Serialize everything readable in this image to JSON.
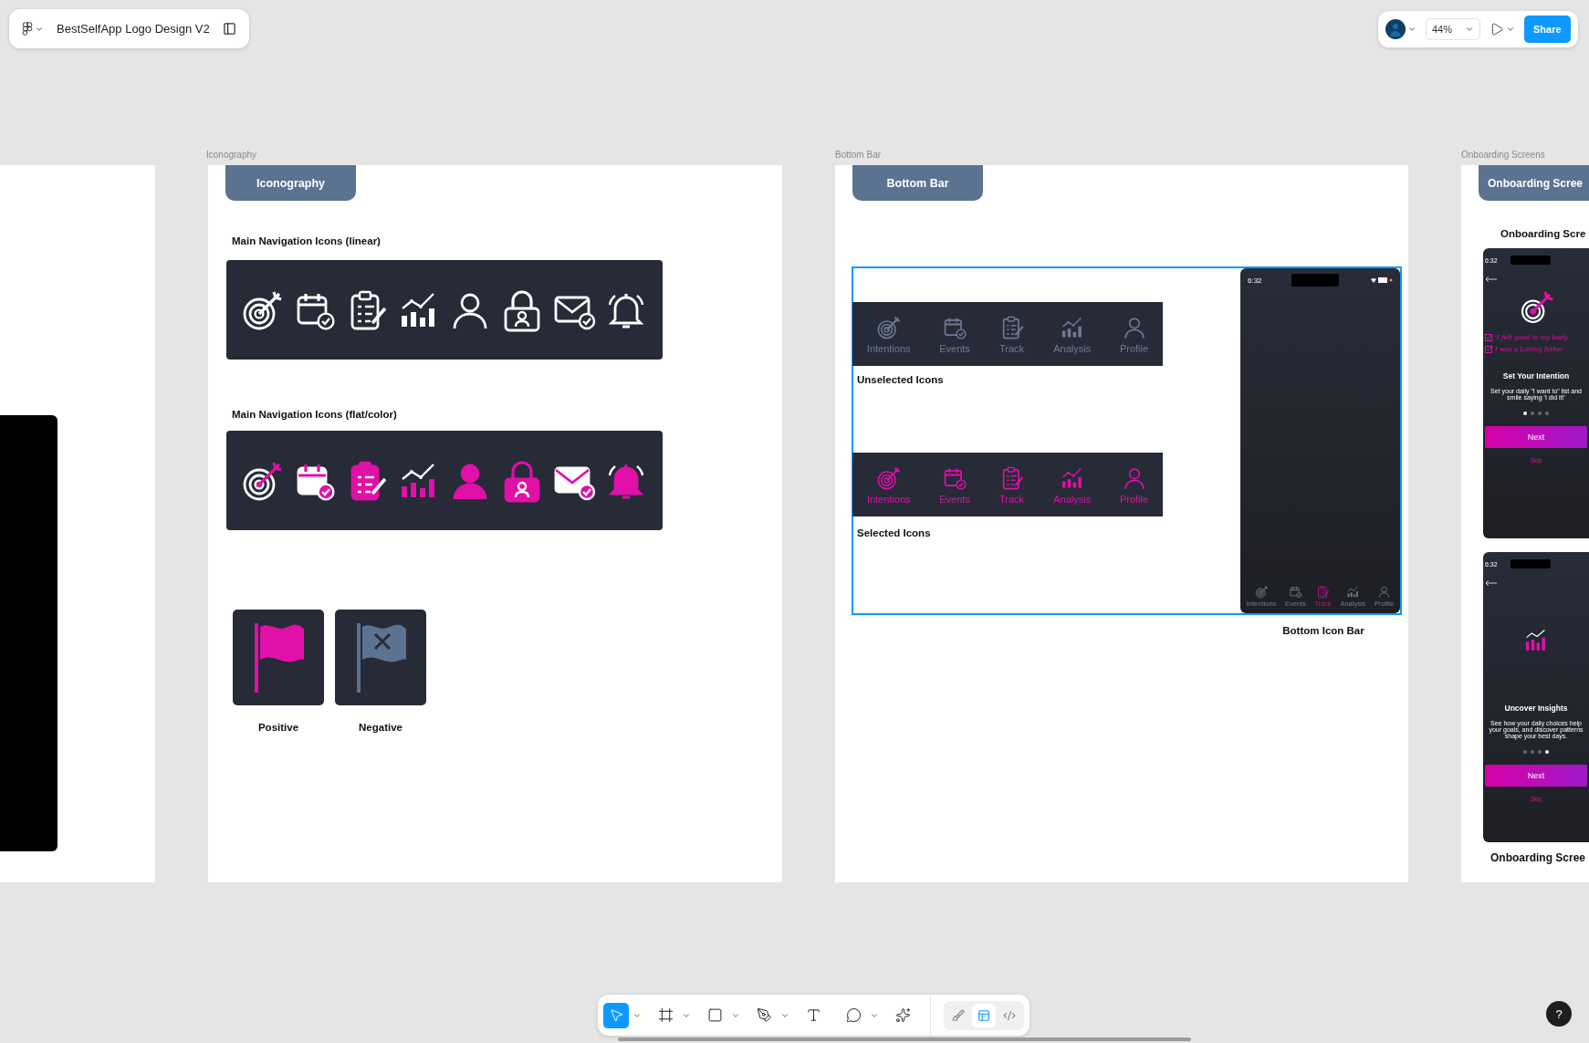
{
  "file": {
    "title": "BestSelfApp Logo Design V2"
  },
  "top_right": {
    "zoom": "44%",
    "share": "Share"
  },
  "iconography": {
    "frame_label": "Iconography",
    "tab": "Iconography",
    "sections": [
      {
        "title": "Main Navigation Icons (linear)",
        "kind": "linear"
      },
      {
        "title": "Main Navigation Icons (flat/color)",
        "kind": "flat"
      }
    ],
    "flags": [
      {
        "label": "Positive",
        "kind": "positive"
      },
      {
        "label": "Negative",
        "kind": "negative"
      }
    ]
  },
  "bottom_bar": {
    "frame_label": "Bottom Bar",
    "tab": "Bottom Bar",
    "group_selected": true,
    "bars": [
      {
        "caption": "Unselected Icons",
        "selected": false,
        "items": [
          "Intentions",
          "Events",
          "Track",
          "Analysis",
          "Profile"
        ]
      },
      {
        "caption": "Selected Icons",
        "selected": true,
        "items": [
          "Intentions",
          "Events",
          "Track",
          "Analysis",
          "Profile"
        ]
      }
    ],
    "phone": {
      "time": "6:32",
      "nav": [
        {
          "label": "Intentions",
          "selected": false
        },
        {
          "label": "Events",
          "selected": false
        },
        {
          "label": "Track",
          "selected": true
        },
        {
          "label": "Analysis",
          "selected": false
        },
        {
          "label": "Profile",
          "selected": false
        }
      ]
    },
    "caption": "Bottom Icon Bar"
  },
  "onboarding": {
    "frame_label": "Onboarding Screens",
    "tab": "Onboarding Scree",
    "heading": "Onboarding Scre",
    "screens": [
      {
        "time": "6:32",
        "kind": "intentions",
        "notes": [
          "'I felt good in my body",
          "I was a Loving father"
        ],
        "title": "Set Your Intention",
        "body": [
          "Set your daily \"I want to\" list and",
          "smile saying 'I did it!'"
        ],
        "dots": [
          {
            "selected": true
          },
          {
            "selected": false
          },
          {
            "selected": false
          },
          {
            "selected": false
          }
        ],
        "button": "Next",
        "skip": "Skip"
      },
      {
        "time": "6:32",
        "kind": "insights",
        "title": "Uncover Insights",
        "body": [
          "See how your daily choices help",
          "your goals, and discover patterns",
          "shape your best days."
        ],
        "dots": [
          {
            "selected": false
          },
          {
            "selected": false
          },
          {
            "selected": false
          },
          {
            "selected": true
          }
        ],
        "button": "Next",
        "skip": "Skip"
      }
    ],
    "caption": "Onboarding Scree"
  },
  "tools": [
    {
      "kind": "move",
      "selected": true,
      "menu": true
    },
    {
      "kind": "frame",
      "selected": false,
      "menu": true
    },
    {
      "kind": "shape",
      "selected": false,
      "menu": true
    },
    {
      "kind": "pen",
      "selected": false,
      "menu": true
    },
    {
      "kind": "text",
      "selected": false,
      "menu": false
    },
    {
      "kind": "comment",
      "selected": false,
      "menu": true
    },
    {
      "kind": "ai",
      "selected": false,
      "menu": false
    }
  ],
  "modes": [
    {
      "kind": "draw",
      "selected": false
    },
    {
      "kind": "design",
      "selected": true
    },
    {
      "kind": "dev",
      "selected": false
    }
  ],
  "help": "?"
}
